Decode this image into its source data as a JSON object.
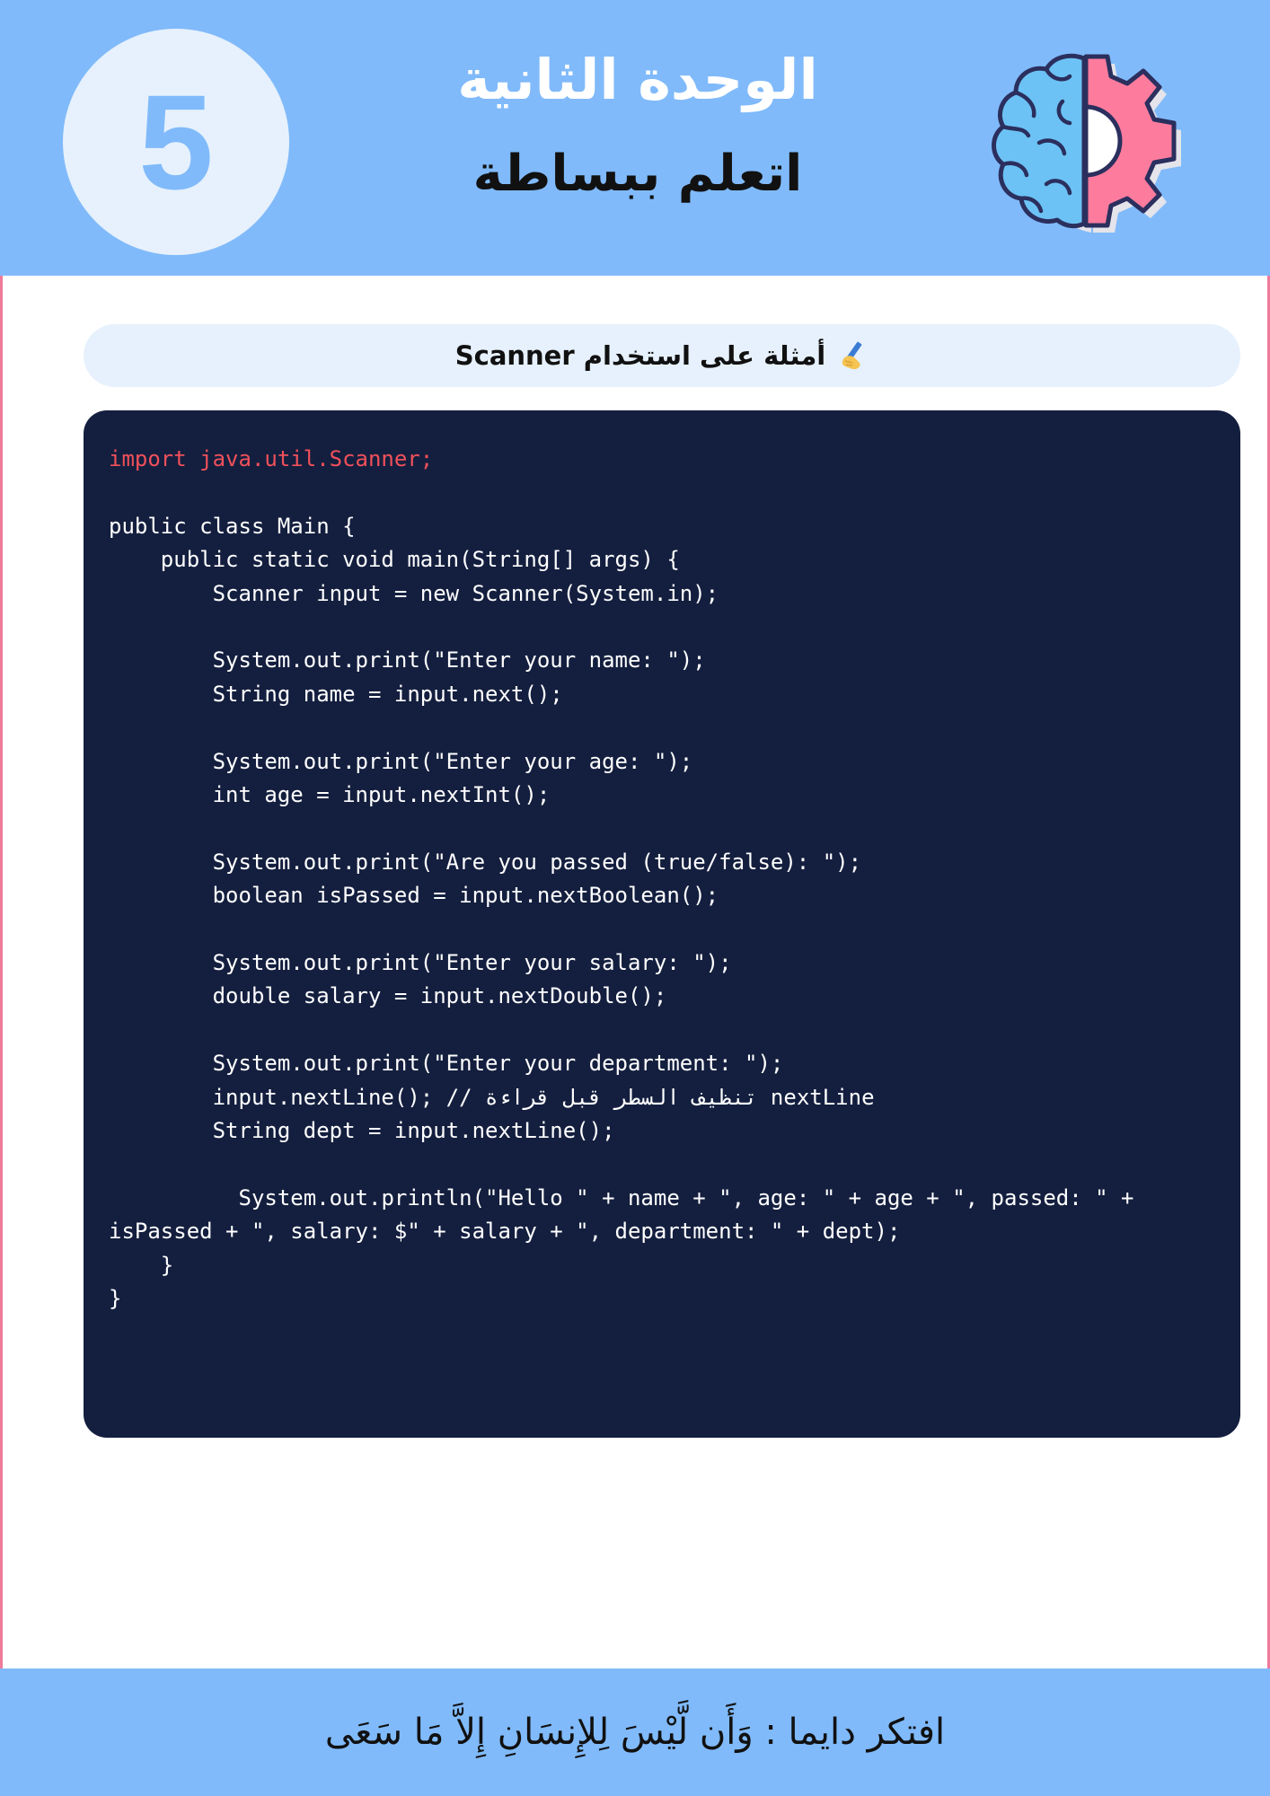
{
  "header": {
    "unit_number": "5",
    "unit_title": "الوحدة الثانية",
    "unit_subtitle": "اتعلم ببساطة",
    "logo_icon": "brain-gear-icon"
  },
  "section": {
    "icon": "writing-hand-icon",
    "title": "أمثلة على استخدام Scanner"
  },
  "code": {
    "lines": [
      "import java.util.Scanner;",
      "",
      "public class Main {",
      "    public static void main(String[] args) {",
      "        Scanner input = new Scanner(System.in);",
      "",
      "        System.out.print(\"Enter your name: \");",
      "        String name = input.next();",
      "",
      "        System.out.print(\"Enter your age: \");",
      "        int age = input.nextInt();",
      "",
      "        System.out.print(\"Are you passed (true/false): \");",
      "        boolean isPassed = input.nextBoolean();",
      "",
      "        System.out.print(\"Enter your salary: \");",
      "        double salary = input.nextDouble();",
      "",
      "        System.out.print(\"Enter your department: \");",
      "        input.nextLine(); // تنظيف السطر قبل قراءة nextLine",
      "        String dept = input.nextLine();",
      "",
      "          System.out.println(\"Hello \" + name + \", age: \" + age + \", passed: \" +",
      "isPassed + \", salary: $\" + salary + \", department: \" + dept);",
      "    }",
      "}"
    ]
  },
  "footer": {
    "text": "افتكر دايما : وَأَن لَّيْسَ لِلإِنسَانِ إِلاَّ مَا سَعَى"
  },
  "colors": {
    "header_bg": "#80bafa",
    "code_bg": "#141f3f",
    "import_color": "#f0505a",
    "frame_border": "#f07a9b"
  }
}
